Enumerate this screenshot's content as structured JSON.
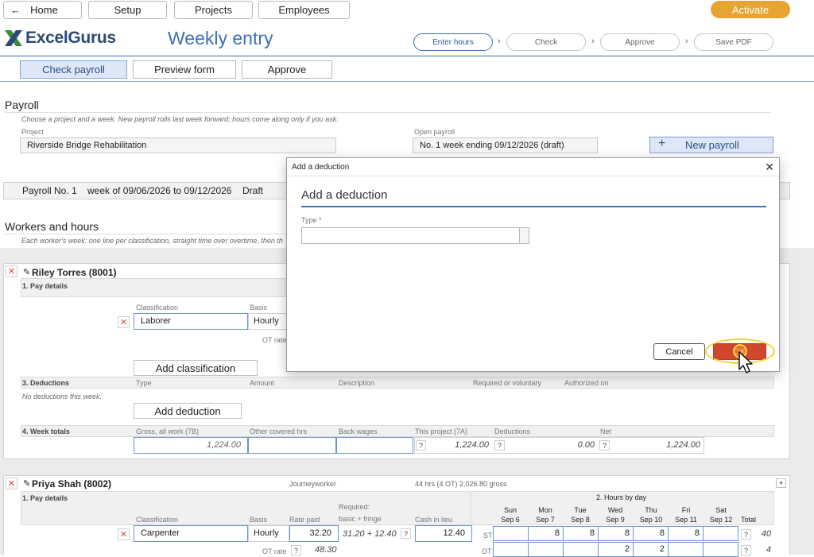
{
  "nav": {
    "home": "Home",
    "setup": "Setup",
    "projects": "Projects",
    "employees": "Employees",
    "activate": "Activate"
  },
  "brand": {
    "name": "ExcelGurus",
    "page_title": "Weekly entry"
  },
  "steps": [
    "Enter hours",
    "Check",
    "Approve",
    "Save PDF"
  ],
  "tabs": [
    "Check payroll",
    "Preview form",
    "Approve"
  ],
  "payroll": {
    "title": "Payroll",
    "hint": "Choose a project and a week. New payroll rolls last week forward; hours come along only if you ask.",
    "project_label": "Project",
    "project_value": "Riverside Bridge Rehabilitation",
    "open_label": "Open payroll",
    "open_value": "No. 1   week ending 09/12/2026  (draft)",
    "new_button": "New payroll",
    "summary_no": "Payroll No. 1",
    "summary_week": "week of 09/06/2026 to 09/12/2026",
    "summary_status": "Draft"
  },
  "workers": {
    "title": "Workers and hours",
    "hint": "Each worker's week: one line per classification, straight time over overtime, then th"
  },
  "worker1": {
    "name": "Riley Torres (8001)",
    "pay_details": "1. Pay details",
    "col_classification": "Classification",
    "col_basis": "Basis",
    "classification": "Laborer",
    "basis": "Hourly",
    "ot_rate": "OT rate",
    "add_classification": "Add classification",
    "deductions": "3. Deductions",
    "ded_cols": [
      "Type",
      "Amount",
      "Description",
      "Required or voluntary",
      "Authorized on"
    ],
    "no_deductions": "No deductions this week.",
    "add_deduction": "Add deduction",
    "totals": "4. Week totals",
    "tot_cols": [
      "Gross, all work (7B)",
      "Other covered hrs",
      "Back wages",
      "This project (7A)",
      "Deductions",
      "Net"
    ],
    "gross": "1,224.00",
    "this_project": "1,224.00",
    "deductions_total": "0.00",
    "net": "1,224.00"
  },
  "worker2": {
    "name": "Priya Shah (8002)",
    "role": "Journeyworker",
    "summary": "44 hrs (4 OT)   2,026.80 gross",
    "pay_details": "1. Pay details",
    "hours_by_day": "2. Hours by day",
    "col_classification": "Classification",
    "col_basis": "Basis",
    "col_rate": "Rate paid",
    "col_required": "Required:",
    "col_required2": "basic + fringe",
    "col_cash": "Cash in lieu",
    "classification": "Carpenter",
    "basis": "Hourly",
    "rate": "32.20",
    "required": "31.20 + 12.40",
    "cash": "12.40",
    "ot_rate": "OT rate",
    "ot_value": "48.30",
    "days": [
      {
        "d": "Sun",
        "date": "Sep 6"
      },
      {
        "d": "Mon",
        "date": "Sep 7"
      },
      {
        "d": "Tue",
        "date": "Sep 8"
      },
      {
        "d": "Wed",
        "date": "Sep 9"
      },
      {
        "d": "Thu",
        "date": "Sep 10"
      },
      {
        "d": "Fri",
        "date": "Sep 11"
      },
      {
        "d": "Sat",
        "date": "Sep 12"
      }
    ],
    "total_label": "Total",
    "st_label": "ST",
    "ot_label": "OT",
    "st_hours": [
      "",
      "8",
      "8",
      "8",
      "8",
      "8",
      ""
    ],
    "ot_hours": [
      "",
      "",
      "",
      "2",
      "2",
      "",
      ""
    ],
    "st_total": "40",
    "ot_total": "4"
  },
  "dialog": {
    "titlebar": "Add a deduction",
    "heading": "Add a deduction",
    "type_label": "Type *",
    "cancel": "Cancel",
    "ok": "OK"
  }
}
